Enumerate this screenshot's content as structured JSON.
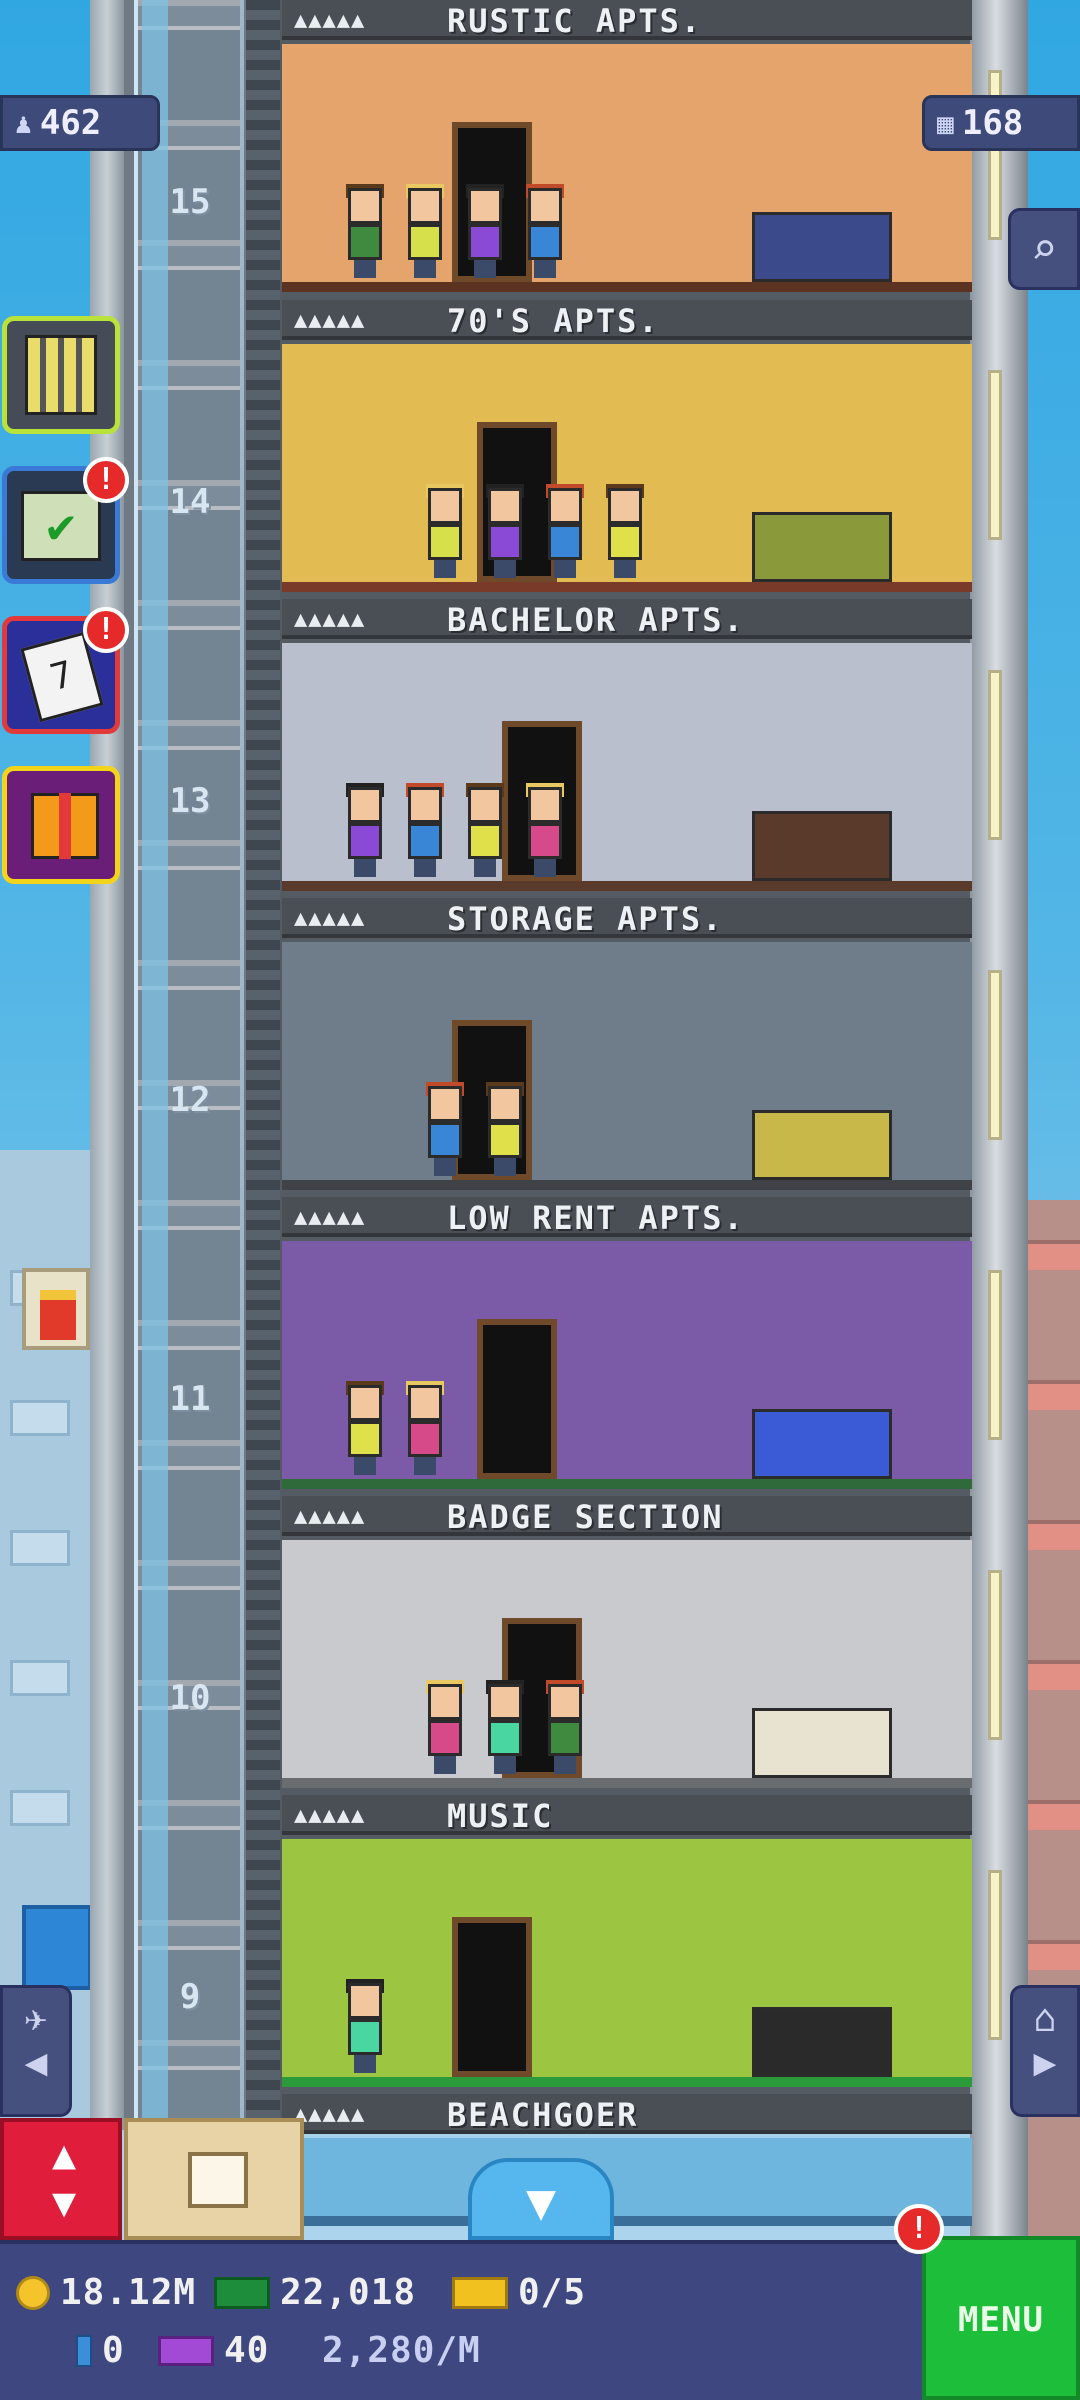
{
  "top_stats": {
    "population": "462",
    "floors_count": "168"
  },
  "side_buttons": [
    {
      "name": "build-button",
      "badge": ""
    },
    {
      "name": "missions-button",
      "badge": "!"
    },
    {
      "name": "calendar-button",
      "badge": "!"
    },
    {
      "name": "gift-button",
      "badge": ""
    }
  ],
  "floors": [
    {
      "number": "15",
      "name": "RUSTIC APTS.",
      "stars": "▲▲▲▲▲",
      "wall": "#e4a46c",
      "floor_color": "#5b3320"
    },
    {
      "number": "14",
      "name": "70'S APTS.",
      "stars": "▲▲▲▲▲",
      "wall": "#e2bb52",
      "floor_color": "#7a3a2a"
    },
    {
      "number": "13",
      "name": "BACHELOR APTS.",
      "stars": "▲▲▲▲▲",
      "wall": "#b9bfcc",
      "floor_color": "#5a3a2a"
    },
    {
      "number": "12",
      "name": "STORAGE APTS.",
      "stars": "▲▲▲▲▲",
      "wall": "#6f7c8a",
      "floor_color": "#3f4348"
    },
    {
      "number": "11",
      "name": "LOW RENT APTS.",
      "stars": "▲▲▲▲▲",
      "wall": "#7b5aa8",
      "floor_color": "#2f6a3a"
    },
    {
      "number": "10",
      "name": "BADGE SECTION",
      "stars": "▲▲▲▲▲",
      "wall": "#c8cacd",
      "floor_color": "#6a6d70"
    },
    {
      "number": "9",
      "name": "MUSIC",
      "stars": "▲▲▲▲▲",
      "wall": "#9cc542",
      "floor_color": "#2a9a3a"
    },
    {
      "number": "",
      "name": "BEACHGOER",
      "stars": "▲▲▲▲▲",
      "wall": "#6fb6de",
      "floor_color": "#3b6f9a"
    }
  ],
  "bottom_bar": {
    "coins": "18.12M",
    "bux": "22,018",
    "tickets": "0/5",
    "gems": "0",
    "vip": "40",
    "rate": "2,280/M",
    "menu_label": "MENU",
    "menu_badge": "!"
  }
}
